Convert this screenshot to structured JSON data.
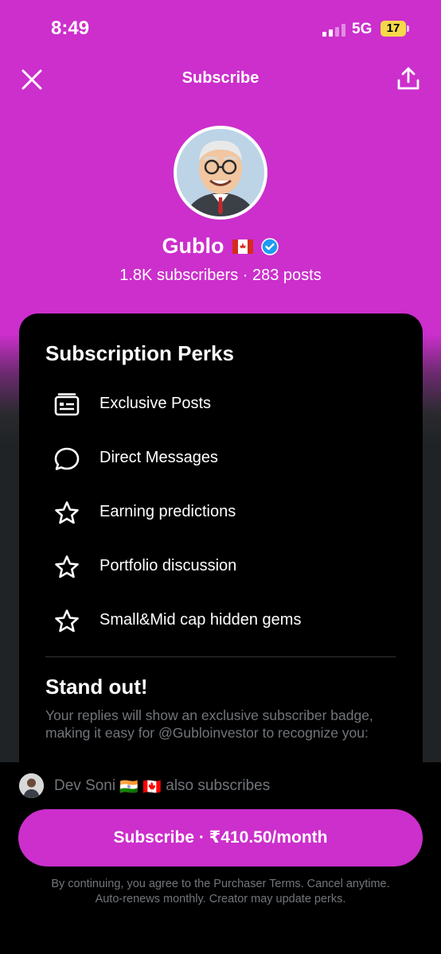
{
  "status_bar": {
    "time": "8:49",
    "network": "5G",
    "battery": "17"
  },
  "nav": {
    "title": "Subscribe",
    "close_icon": "close-icon",
    "share_icon": "share-icon"
  },
  "profile": {
    "name": "Gublo",
    "flag": "🇨🇦",
    "verified": true,
    "subscribers": "1.8K subscribers",
    "posts": "283 posts",
    "stats_separator": " · "
  },
  "perks": {
    "title": "Subscription Perks",
    "items": [
      {
        "label": "Exclusive Posts",
        "icon": "posts-icon"
      },
      {
        "label": "Direct Messages",
        "icon": "message-icon"
      },
      {
        "label": "Earning predictions",
        "icon": "star-icon"
      },
      {
        "label": "Portfolio discussion",
        "icon": "star-icon"
      },
      {
        "label": "Small&Mid cap hidden gems",
        "icon": "star-icon"
      }
    ]
  },
  "standout": {
    "title": "Stand out!",
    "text": "Your replies will show an exclusive subscriber badge, making it easy for @Gubloinvestor to recognize you:"
  },
  "bottom": {
    "also_name": "Dev Soni",
    "also_flags": "🇮🇳 🇨🇦",
    "also_suffix": "also subscribes",
    "subscribe_label": "Subscribe · ₹410.50/month",
    "terms_line1": "By continuing, you agree to the Purchaser Terms. Cancel anytime.",
    "terms_line2": "Auto-renews monthly. Creator may update perks."
  },
  "colors": {
    "accent": "#cc2fcc",
    "background": "#000000",
    "secondary_text": "#71767b",
    "verified": "#1d9bf0"
  }
}
